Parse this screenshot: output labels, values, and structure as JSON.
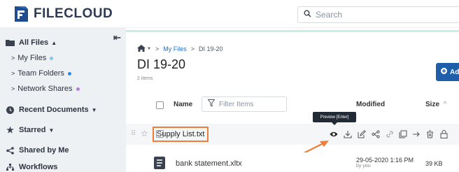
{
  "header": {
    "logo_text": "FILECLOUD",
    "search_placeholder": "Search"
  },
  "sidebar": {
    "items": [
      {
        "label": "All Files"
      },
      {
        "label": "My Files"
      },
      {
        "label": "Team Folders"
      },
      {
        "label": "Network Shares"
      },
      {
        "label": "Recent Documents"
      },
      {
        "label": "Starred"
      },
      {
        "label": "Shared by Me"
      },
      {
        "label": "Workflows"
      }
    ]
  },
  "main": {
    "breadcrumb": {
      "my_files": "My Files",
      "current": "DI 19-20"
    },
    "title": "DI 19-20",
    "items_count": "2 items",
    "add_button": "Ad",
    "columns": {
      "name": "Name",
      "filter_placeholder": "Filter Items",
      "modified": "Modified",
      "size": "Size"
    },
    "tooltip": "Preview [Enter]",
    "rows": [
      {
        "name": "Supply List.txt"
      },
      {
        "name": "bank statement.xltx",
        "modified": "29-05-2020 1:16 PM",
        "by": "by you",
        "size": "39 KB"
      }
    ]
  },
  "colors": {
    "accent": "#1f5ea8",
    "highlight": "#f07d3a",
    "dot_my_files": "#7fc8ee",
    "dot_team_folders": "#2a8fe0",
    "dot_network_shares": "#b67be8"
  }
}
